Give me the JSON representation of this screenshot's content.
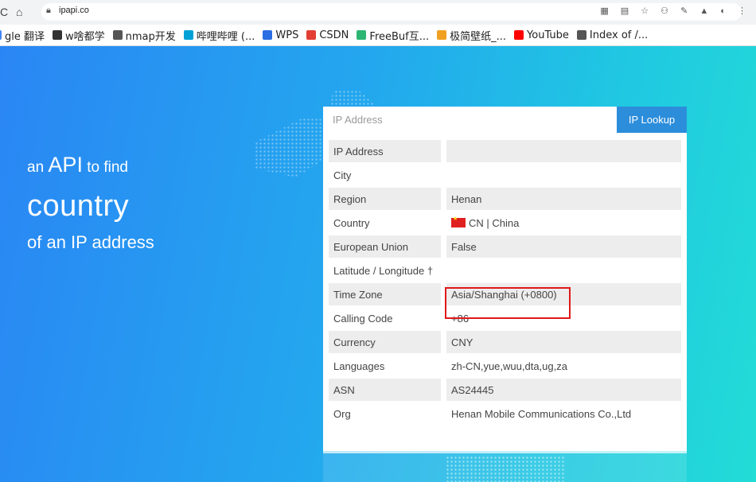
{
  "browser": {
    "url": "ipapi.co",
    "bookmarks": [
      {
        "label": "gle 翻译",
        "icon": "translate-icon",
        "color": "#4285f4"
      },
      {
        "label": "w啥都学",
        "icon": "panda-icon",
        "color": "#333333"
      },
      {
        "label": "nmap开发",
        "icon": "globe-icon",
        "color": "#555555"
      },
      {
        "label": "哔哩哔哩 (...",
        "icon": "bilibili-icon",
        "color": "#00a1d6"
      },
      {
        "label": "WPS",
        "icon": "wps-icon",
        "color": "#2b6de3"
      },
      {
        "label": "CSDN",
        "icon": "csdn-icon",
        "color": "#e33e33"
      },
      {
        "label": "FreeBuf互...",
        "icon": "freebuf-icon",
        "color": "#2bb673"
      },
      {
        "label": "极简壁纸_...",
        "icon": "wallpaper-icon",
        "color": "#f0a020"
      },
      {
        "label": "YouTube",
        "icon": "youtube-icon",
        "color": "#ff0000"
      },
      {
        "label": "Index of /...",
        "icon": "globe-icon",
        "color": "#555555"
      }
    ]
  },
  "hero": {
    "line1_pre": "an",
    "line1_big": "API",
    "line1_post": "to find",
    "line2": "country",
    "line3": "of an IP address"
  },
  "lookup": {
    "placeholder": "IP Address",
    "button": "IP Lookup"
  },
  "results": [
    {
      "key": "IP Address",
      "value": ""
    },
    {
      "key": "City",
      "value": ""
    },
    {
      "key": "Region",
      "value": "Henan"
    },
    {
      "key": "Country",
      "value": "CN | China",
      "flag": true
    },
    {
      "key": "European Union",
      "value": "False"
    },
    {
      "key": "Latitude / Longitude †",
      "value": ""
    },
    {
      "key": "Time Zone",
      "value": "Asia/Shanghai (+0800)"
    },
    {
      "key": "Calling Code",
      "value": "+86"
    },
    {
      "key": "Currency",
      "value": "CNY"
    },
    {
      "key": "Languages",
      "value": "zh-CN,yue,wuu,dta,ug,za"
    },
    {
      "key": "ASN",
      "value": "AS24445"
    },
    {
      "key": "Org",
      "value": "Henan Mobile Communications Co.,Ltd"
    }
  ]
}
